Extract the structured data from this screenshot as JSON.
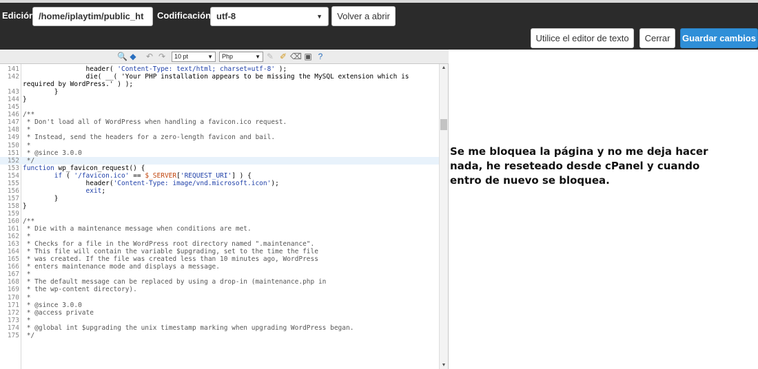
{
  "header": {
    "edicion_label": "Edición:",
    "path_value": "/home/iplaytim/public_ht",
    "codificacion_label": "Codificación:",
    "encoding_value": "utf-8",
    "reopen_button": "Volver a abrir"
  },
  "actions": {
    "text_editor_button": "Utilice el editor de texto",
    "close_button": "Cerrar",
    "save_button": "Guardar cambios"
  },
  "toolbar": {
    "font_size": "10 pt",
    "language": "Php",
    "icons": [
      "find-icon",
      "replace-icon",
      "undo-icon",
      "redo-icon",
      "highlight-icon",
      "reset-icon",
      "clear-icon",
      "fullscreen-icon",
      "help-icon"
    ]
  },
  "code_lines": [
    {
      "n": "141",
      "t": "                header( 'Content-Type: text/html; charset=utf-8' );"
    },
    {
      "n": "142",
      "t": "                die( __( 'Your PHP installation appears to be missing the MySQL extension which is"
    },
    {
      "n": "",
      "t": "required by WordPress.' ) );"
    },
    {
      "n": "143",
      "t": "        }"
    },
    {
      "n": "144",
      "t": "}"
    },
    {
      "n": "145",
      "t": ""
    },
    {
      "n": "146",
      "t": "/**"
    },
    {
      "n": "147",
      "t": " * Don't load all of WordPress when handling a favicon.ico request."
    },
    {
      "n": "148",
      "t": " *"
    },
    {
      "n": "149",
      "t": " * Instead, send the headers for a zero-length favicon and bail."
    },
    {
      "n": "150",
      "t": " *"
    },
    {
      "n": "151",
      "t": " * @since 3.0.0"
    },
    {
      "n": "152",
      "t": " */"
    },
    {
      "n": "153",
      "t": "function wp_favicon_request() {"
    },
    {
      "n": "154",
      "t": "        if ( '/favicon.ico' == $_SERVER['REQUEST_URI'] ) {"
    },
    {
      "n": "155",
      "t": "                header('Content-Type: image/vnd.microsoft.icon');"
    },
    {
      "n": "156",
      "t": "                exit;"
    },
    {
      "n": "157",
      "t": "        }"
    },
    {
      "n": "158",
      "t": "}"
    },
    {
      "n": "159",
      "t": ""
    },
    {
      "n": "160",
      "t": "/**"
    },
    {
      "n": "161",
      "t": " * Die with a maintenance message when conditions are met."
    },
    {
      "n": "162",
      "t": " *"
    },
    {
      "n": "163",
      "t": " * Checks for a file in the WordPress root directory named \".maintenance\"."
    },
    {
      "n": "164",
      "t": " * This file will contain the variable $upgrading, set to the time the file"
    },
    {
      "n": "165",
      "t": " * was created. If the file was created less than 10 minutes ago, WordPress"
    },
    {
      "n": "166",
      "t": " * enters maintenance mode and displays a message."
    },
    {
      "n": "167",
      "t": " *"
    },
    {
      "n": "168",
      "t": " * The default message can be replaced by using a drop-in (maintenance.php in"
    },
    {
      "n": "169",
      "t": " * the wp-content directory)."
    },
    {
      "n": "170",
      "t": " *"
    },
    {
      "n": "171",
      "t": " * @since 3.0.0"
    },
    {
      "n": "172",
      "t": " * @access private"
    },
    {
      "n": "173",
      "t": " *"
    },
    {
      "n": "174",
      "t": " * @global int $upgrading the unix timestamp marking when upgrading WordPress began."
    },
    {
      "n": "175",
      "t": " */"
    }
  ],
  "highlighted_line": "152",
  "overlay_text": [
    "Se me bloquea la página y no me deja hacer",
    "nada, he reseteado desde cPanel y cuando",
    "entro de nuevo se bloquea."
  ]
}
